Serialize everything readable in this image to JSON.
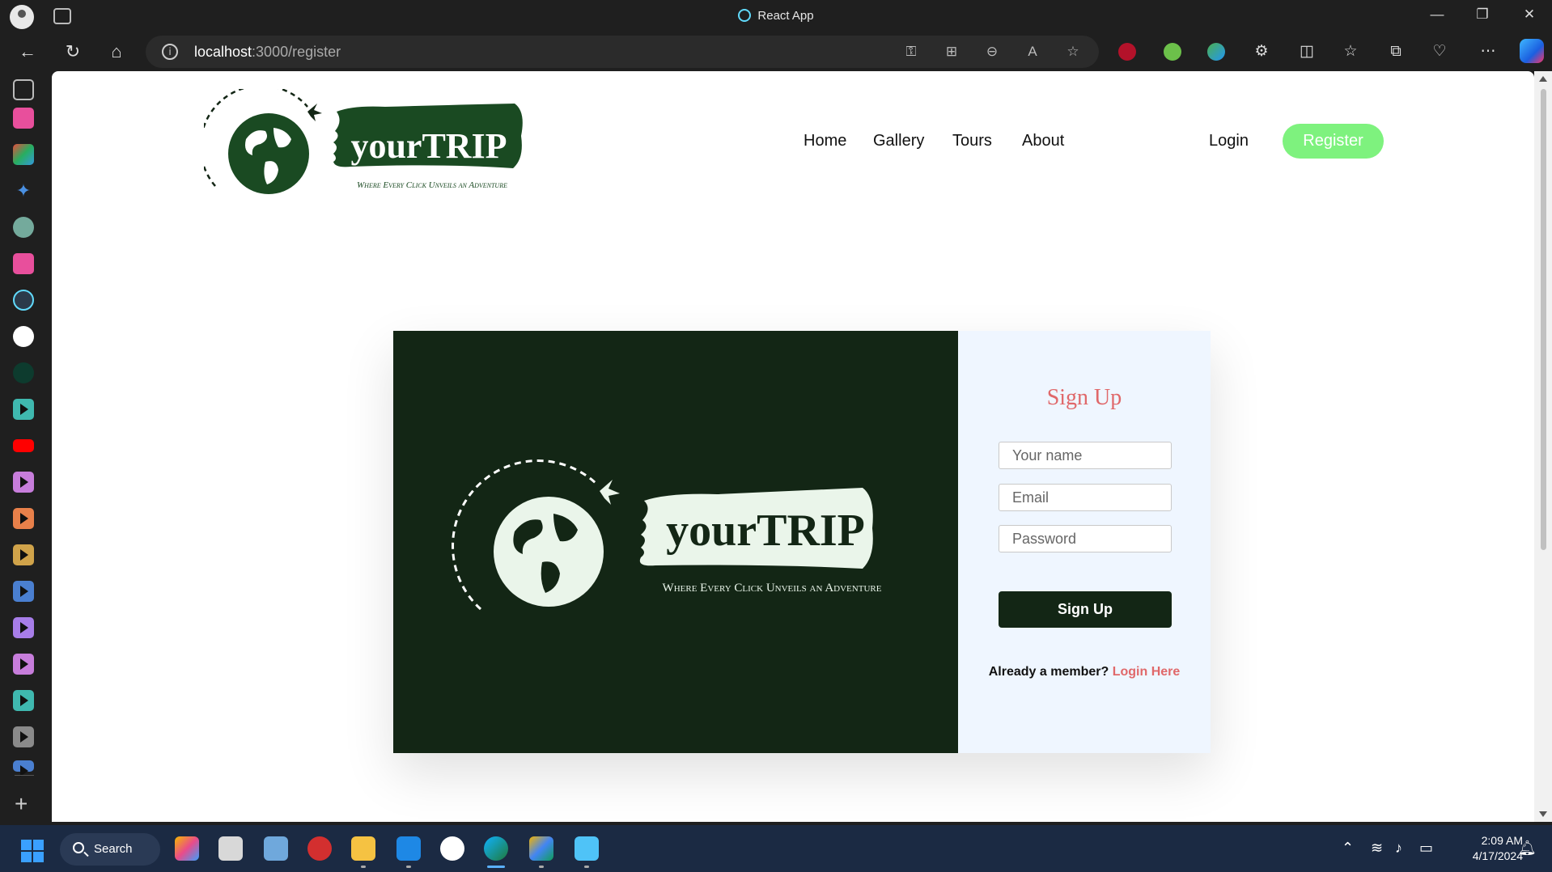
{
  "window": {
    "title": "React App"
  },
  "browser": {
    "url_host": "localhost",
    "url_path": ":3000/register"
  },
  "site": {
    "brand": "yourTRIP",
    "tagline": "Where Every Click Unveils an Adventure",
    "nav": [
      "Home",
      "Gallery",
      "Tours",
      "About"
    ],
    "login": "Login",
    "register": "Register"
  },
  "form": {
    "title": "Sign Up",
    "name_placeholder": "Your name",
    "email_placeholder": "Email",
    "password_placeholder": "Password",
    "submit": "Sign Up",
    "member_text": "Already a member?",
    "login_link": "Login Here"
  },
  "taskbar": {
    "search": "Search",
    "time": "2:09 AM",
    "date": "4/17/2024"
  },
  "colors": {
    "dark_green": "#132615",
    "accent_red": "#e0686a",
    "register_green": "#7ef27e",
    "form_bg": "#eff6ff"
  }
}
